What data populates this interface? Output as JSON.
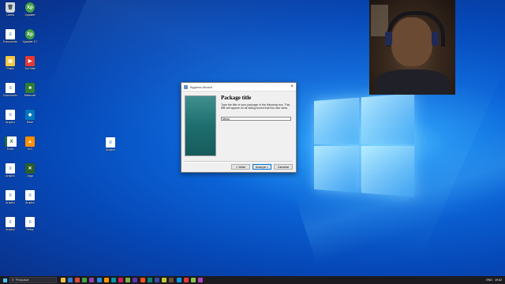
{
  "desktop": {
    "icons": [
      {
        "label": "Lixeira",
        "glyph": "🗑",
        "kind": "g-trash",
        "icon": "recycle-bin-icon"
      },
      {
        "label": "Xpadder",
        "glyph": "Xp",
        "kind": "g-xp",
        "icon": "xpadder-icon"
      },
      {
        "label": "Documento",
        "glyph": "≡",
        "kind": "g-file",
        "icon": "document-icon"
      },
      {
        "label": "Xpadder 5.7",
        "glyph": "Xp",
        "kind": "g-xp",
        "icon": "xpadder-icon"
      },
      {
        "label": "Pasta",
        "glyph": "▤",
        "kind": "g-fold",
        "icon": "folder-icon"
      },
      {
        "label": "YouTube",
        "glyph": "▶",
        "kind": "g-yt",
        "icon": "youtube-icon"
      },
      {
        "label": "Documento",
        "glyph": "≡",
        "kind": "g-file",
        "icon": "document-icon"
      },
      {
        "label": "Minecraft",
        "glyph": "■",
        "kind": "g-mc",
        "icon": "minecraft-icon"
      },
      {
        "label": "Arquivo",
        "glyph": "≡",
        "kind": "g-file",
        "icon": "file-icon"
      },
      {
        "label": "Rede",
        "glyph": "◆",
        "kind": "g-net",
        "icon": "network-icon"
      },
      {
        "label": "Excel",
        "glyph": "X",
        "kind": "g-excel",
        "icon": "excel-icon"
      },
      {
        "label": "VLC",
        "glyph": "▲",
        "kind": "g-vlc",
        "icon": "vlc-icon"
      },
      {
        "label": "Arquivo",
        "glyph": "≡",
        "kind": "g-file",
        "icon": "file-icon"
      },
      {
        "label": "Jogo",
        "glyph": "✕",
        "kind": "g-green",
        "icon": "app-icon"
      },
      {
        "label": "Arquivo",
        "glyph": "≡",
        "kind": "g-file",
        "icon": "file-icon"
      },
      {
        "label": "Arquivo",
        "glyph": "≡",
        "kind": "g-file",
        "icon": "file-icon"
      },
      {
        "label": "Arquivo",
        "glyph": "≡",
        "kind": "g-file",
        "icon": "file-icon"
      },
      {
        "label": "Setup",
        "glyph": "≡",
        "kind": "g-file",
        "icon": "file-icon"
      }
    ]
  },
  "wizard": {
    "title": "Bygress Wizard",
    "heading": "Package title",
    "description": "Type the title of your package in the following box. This title will appear on all dialog boxes that the user sees.",
    "input_value": "Menu",
    "buttons": {
      "back": "< Voltar",
      "next": "Avançar >",
      "cancel": "Cancelar"
    }
  },
  "taskbar": {
    "search_placeholder": "Pesquisar",
    "apps": [
      "#f4c042",
      "#2d7de0",
      "#e04b3c",
      "#43a047",
      "#8e44ad",
      "#1e88e5",
      "#ff9800",
      "#0097a7",
      "#d81b60",
      "#7cb342",
      "#5e35b1",
      "#f4511e",
      "#00897b",
      "#3949ab",
      "#c0ca33",
      "#6d4c41",
      "#039be5",
      "#e53935",
      "#8bc34a",
      "#ab47bc"
    ],
    "tray": {
      "language": "ENG",
      "time": "19:42"
    }
  }
}
